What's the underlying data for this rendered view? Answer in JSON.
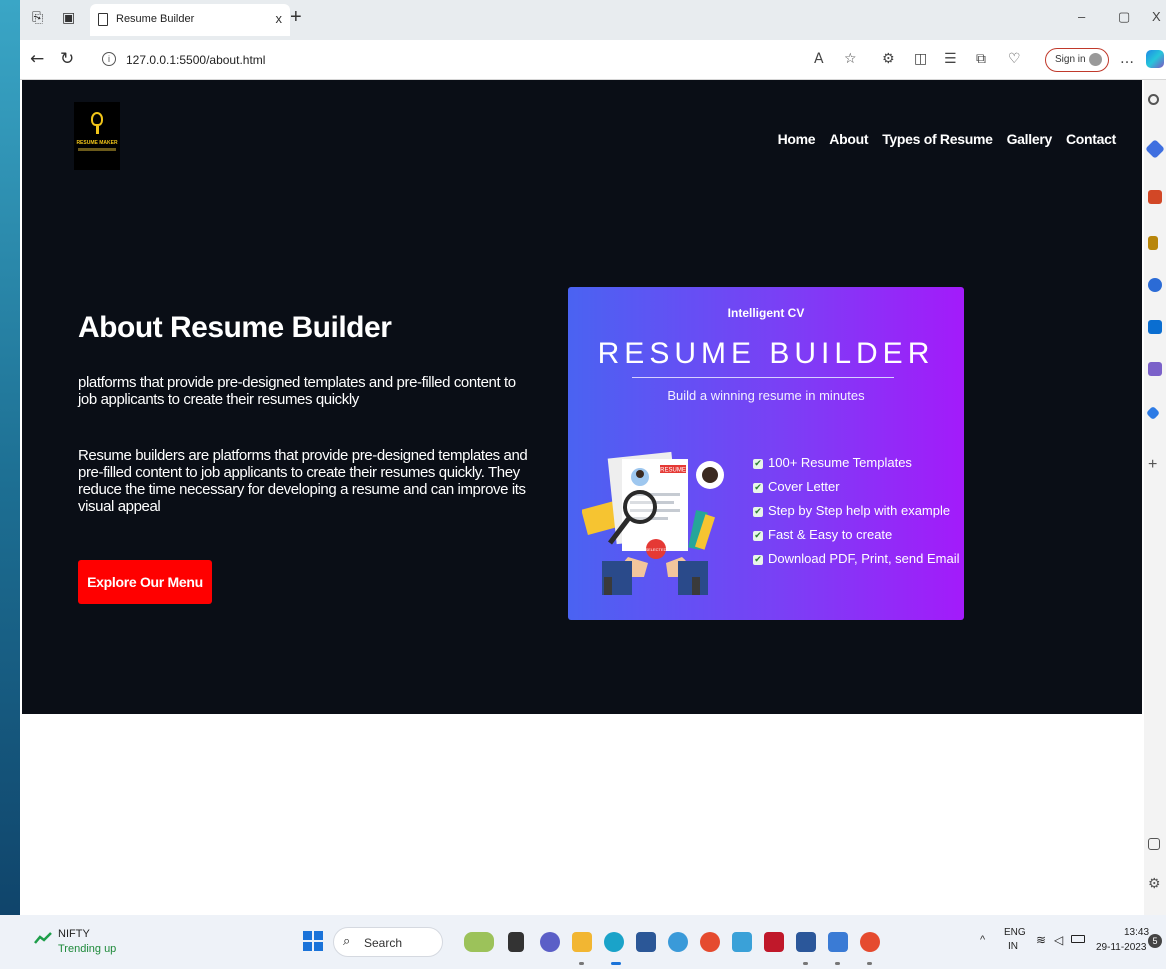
{
  "browser": {
    "tab_title": "Resume Builder",
    "tab_close": "x",
    "new_tab": "+",
    "url": "127.0.0.1:5500/about.html",
    "sign_in": "Sign in",
    "window_min": "–",
    "window_max": "▢",
    "window_close": "X"
  },
  "site": {
    "logo_text": "RESUME MAKER",
    "nav": [
      "Home",
      "About",
      "Types of Resume",
      "Gallery",
      "Contact"
    ],
    "heading": "About Resume Builder",
    "paragraph1": "platforms that provide pre-designed templates and pre-filled content to job applicants to create their resumes quickly",
    "paragraph2": "Resume builders are platforms that provide pre-designed templates and pre-filled content to job applicants to create their resumes quickly. They reduce the time necessary for developing a resume and can improve its visual appeal",
    "cta": "Explore Our Menu"
  },
  "banner": {
    "eyebrow": "Intelligent CV",
    "title": "RESUME BUILDER",
    "subtitle": "Build a winning resume in minutes",
    "features": [
      "100+ Resume Templates",
      "Cover Letter",
      "Step by Step help with example",
      "Fast & Easy to create",
      "Download PDF, Print, send Email"
    ],
    "paper_label": "RESUME",
    "stamp_label": "SELECTED"
  },
  "taskbar": {
    "stock_name": "NIFTY",
    "stock_status": "Trending up",
    "search_label": "Search",
    "lang": "ENG",
    "region": "IN",
    "time": "13:43",
    "date": "29-11-2023",
    "notif_count": "5"
  }
}
